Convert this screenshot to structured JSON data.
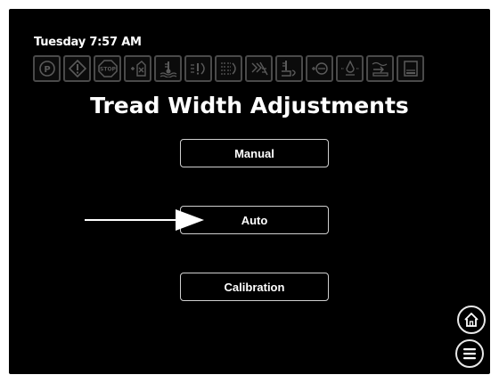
{
  "status": {
    "datetime": "Tuesday 7:57 AM"
  },
  "icons": [
    "park-brake-icon",
    "warning-icon",
    "stop-icon",
    "fuel-water-icon",
    "coolant-temp-icon",
    "hydraulic-filter-icon",
    "transmission-filter-icon",
    "air-filter-restriction-icon",
    "hydraulic-oil-temp-icon",
    "transmission-oil-icon",
    "engine-oil-pressure-icon",
    "fluid-low-icon",
    "def-level-icon"
  ],
  "page": {
    "title": "Tread Width Adjustments"
  },
  "buttons": {
    "manual": "Manual",
    "auto": "Auto",
    "calibration": "Calibration"
  },
  "nav": {
    "home_icon": "home-icon",
    "menu_icon": "menu-icon"
  },
  "colors": {
    "background": "#000000",
    "icon_border": "#4a4a4a",
    "icon_glyph": "#5a5a5a",
    "text": "#ffffff"
  }
}
